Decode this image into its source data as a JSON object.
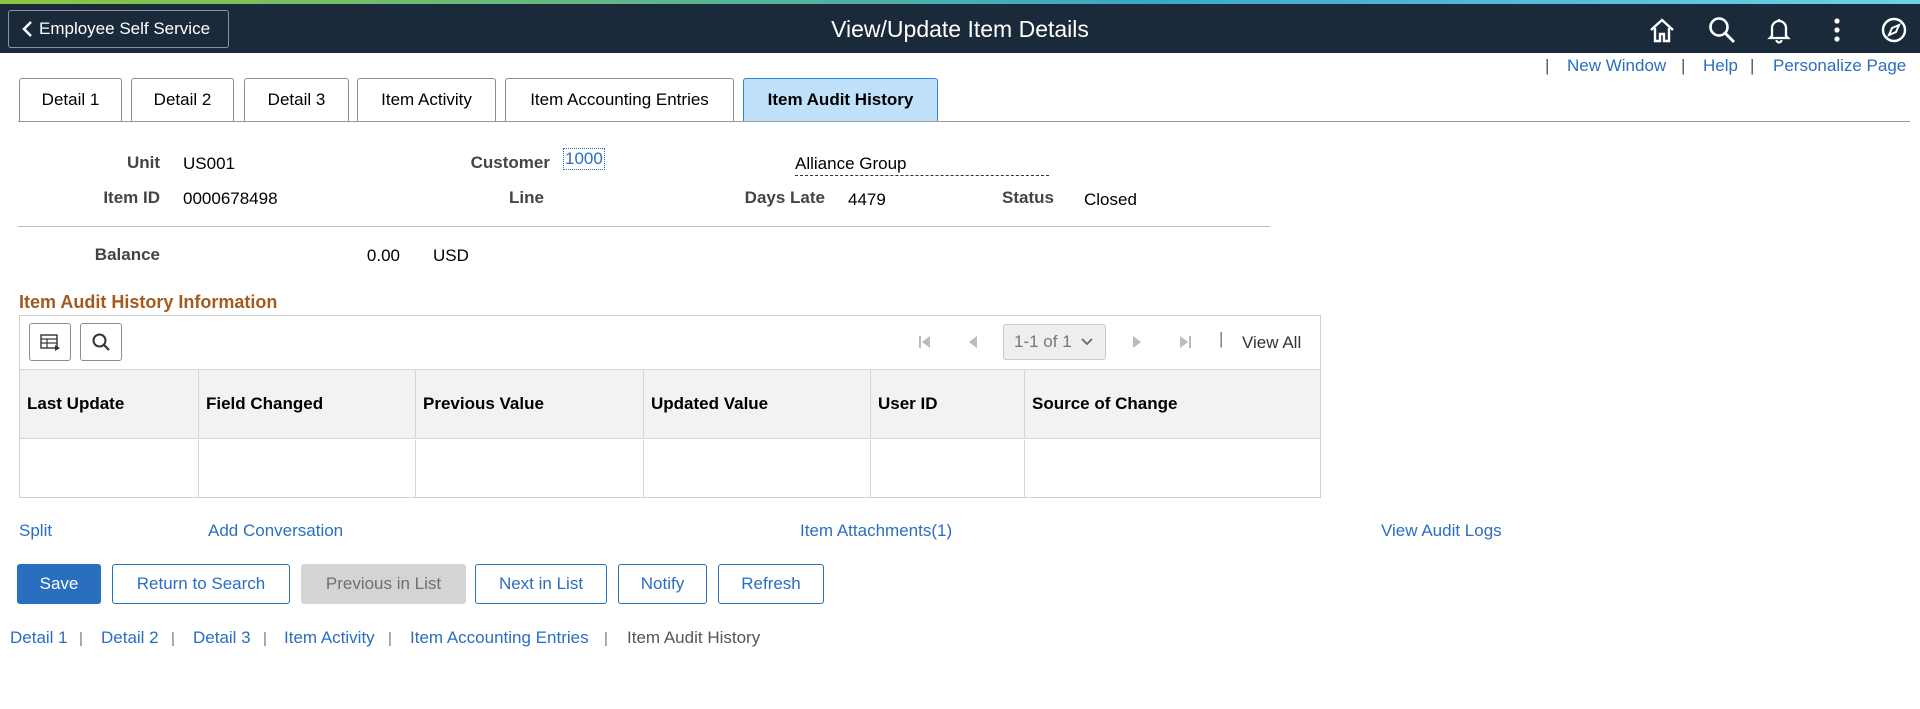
{
  "header": {
    "back_label": "Employee Self Service",
    "title": "View/Update Item Details",
    "icons": [
      "home-icon",
      "search-icon",
      "bell-icon",
      "more-vertical-icon",
      "compass-icon"
    ]
  },
  "utility_links": {
    "new_window": "New Window",
    "help": "Help",
    "personalize": "Personalize Page"
  },
  "tabs": [
    {
      "label": "Detail 1",
      "active": false
    },
    {
      "label": "Detail 2",
      "active": false
    },
    {
      "label": "Detail 3",
      "active": false
    },
    {
      "label": "Item Activity",
      "active": false
    },
    {
      "label": "Item Accounting Entries",
      "active": false
    },
    {
      "label": "Item Audit History",
      "active": true
    }
  ],
  "item": {
    "unit_label": "Unit",
    "unit_value": "US001",
    "customer_label": "Customer",
    "customer_value": "1000",
    "customer_name": "Alliance Group",
    "item_id_label": "Item ID",
    "item_id_value": "0000678498",
    "line_label": "Line",
    "days_late_label": "Days Late",
    "days_late_value": "4479",
    "status_label": "Status",
    "status_value": "Closed",
    "balance_label": "Balance",
    "balance_value": "0.00",
    "balance_currency": "USD"
  },
  "audit": {
    "title": "Item Audit History Information",
    "pager_text": "1-1 of 1",
    "view_all": "View All",
    "columns": [
      "Last Update",
      "Field Changed",
      "Previous Value",
      "Updated Value",
      "User ID",
      "Source of Change"
    ]
  },
  "action_links": {
    "split": "Split",
    "add_conversation": "Add Conversation",
    "attachments": "Item Attachments(1)",
    "view_audit_logs": "View Audit Logs"
  },
  "buttons": {
    "save": "Save",
    "return_to_search": "Return to Search",
    "previous_in_list": "Previous in List",
    "next_in_list": "Next in List",
    "notify": "Notify",
    "refresh": "Refresh"
  },
  "bottom_tabs": [
    "Detail 1",
    "Detail 2",
    "Detail 3",
    "Item Activity",
    "Item Accounting Entries",
    "Item Audit History"
  ],
  "colors": {
    "header_bg": "#1b2a3a",
    "link": "#2a6ec0",
    "active_tab": "#bfe2fa",
    "section_title": "#a35a1c",
    "primary_button": "#2a6ec0"
  }
}
